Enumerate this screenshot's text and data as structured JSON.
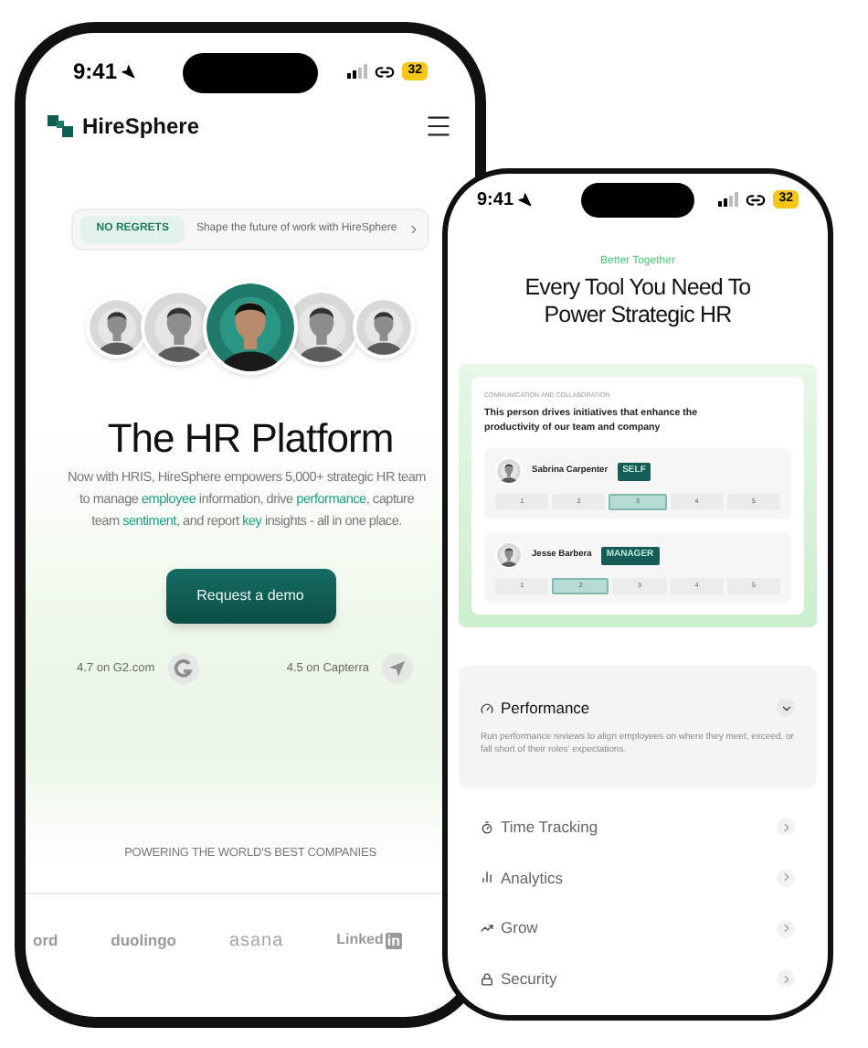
{
  "home_phone": {
    "status_bar": {
      "time": "9:41",
      "battery": "32"
    },
    "header": {
      "brand": "HireSphere"
    },
    "announcement": {
      "tag": "NO REGRETS",
      "text": "Shape the future of work with HireSphere"
    },
    "avatars": [
      {
        "featured": false
      },
      {
        "featured": false
      },
      {
        "featured": true
      },
      {
        "featured": false
      },
      {
        "featured": false
      }
    ],
    "hero": {
      "title": "The HR Platform",
      "lines": [
        [
          {
            "text": "Now with HRIS, HireSphere empowers 5,000+ strategic HR team",
            "highlight": false
          }
        ],
        [
          {
            "text": "to manage ",
            "highlight": false
          },
          {
            "text": "employee",
            "highlight": true
          },
          {
            "text": " information, drive ",
            "highlight": false
          },
          {
            "text": "performance",
            "highlight": true
          },
          {
            "text": ", capture",
            "highlight": false
          }
        ],
        [
          {
            "text": "team ",
            "highlight": false
          },
          {
            "text": "sentiment",
            "highlight": true
          },
          {
            "text": ", and report ",
            "highlight": false
          },
          {
            "text": "key",
            "highlight": true
          },
          {
            "text": " insights - all in one place.",
            "highlight": false
          }
        ]
      ],
      "cta": "Request a demo"
    },
    "ratings": [
      {
        "kind": "g2",
        "text": "4.7 on G2.com"
      },
      {
        "kind": "capterra",
        "text": "4.5 on Capterra"
      }
    ],
    "logos_caption": "POWERING THE WORLD'S BEST COMPANIES",
    "logos": [
      {
        "kind": "text",
        "text": "ord"
      },
      {
        "kind": "text",
        "text": "duolingo"
      },
      {
        "kind": "thin",
        "text": "asana"
      },
      {
        "kind": "linkedin",
        "text": "Linked",
        "badge": "in"
      }
    ]
  },
  "features_phone": {
    "status_bar": {
      "time": "9:41",
      "battery": "32"
    },
    "eyebrow": "Better Together",
    "title_lines": [
      "Every Tool You Need To",
      "Power Strategic HR"
    ],
    "review_card": {
      "category": "COMMUNICATION AND COLLABORATION",
      "statement": "This person drives initiatives that enhance the productivity of our team and company",
      "reviewers": [
        {
          "name": "Sabrina Carpenter",
          "role": "SELF",
          "options": [
            {
              "label": "1",
              "selected": false
            },
            {
              "label": "2",
              "selected": false
            },
            {
              "label": "3",
              "selected": true
            },
            {
              "label": "4",
              "selected": false
            },
            {
              "label": "5",
              "selected": false
            }
          ]
        },
        {
          "name": "Jesse Barbera",
          "role": "MANAGER",
          "options": [
            {
              "label": "1",
              "selected": false
            },
            {
              "label": "2",
              "selected": true
            },
            {
              "label": "3",
              "selected": false
            },
            {
              "label": "4",
              "selected": false
            },
            {
              "label": "5",
              "selected": false
            }
          ]
        }
      ]
    },
    "features": [
      {
        "title": "Performance",
        "expanded": true,
        "description": "Run performance reviews to align employees on where they meet, exceed, or fall short of their roles' expectations."
      },
      {
        "title": "Time Tracking",
        "expanded": false
      },
      {
        "title": "Analytics",
        "expanded": false
      },
      {
        "title": "Grow",
        "expanded": false
      },
      {
        "title": "Security",
        "expanded": false
      }
    ]
  }
}
